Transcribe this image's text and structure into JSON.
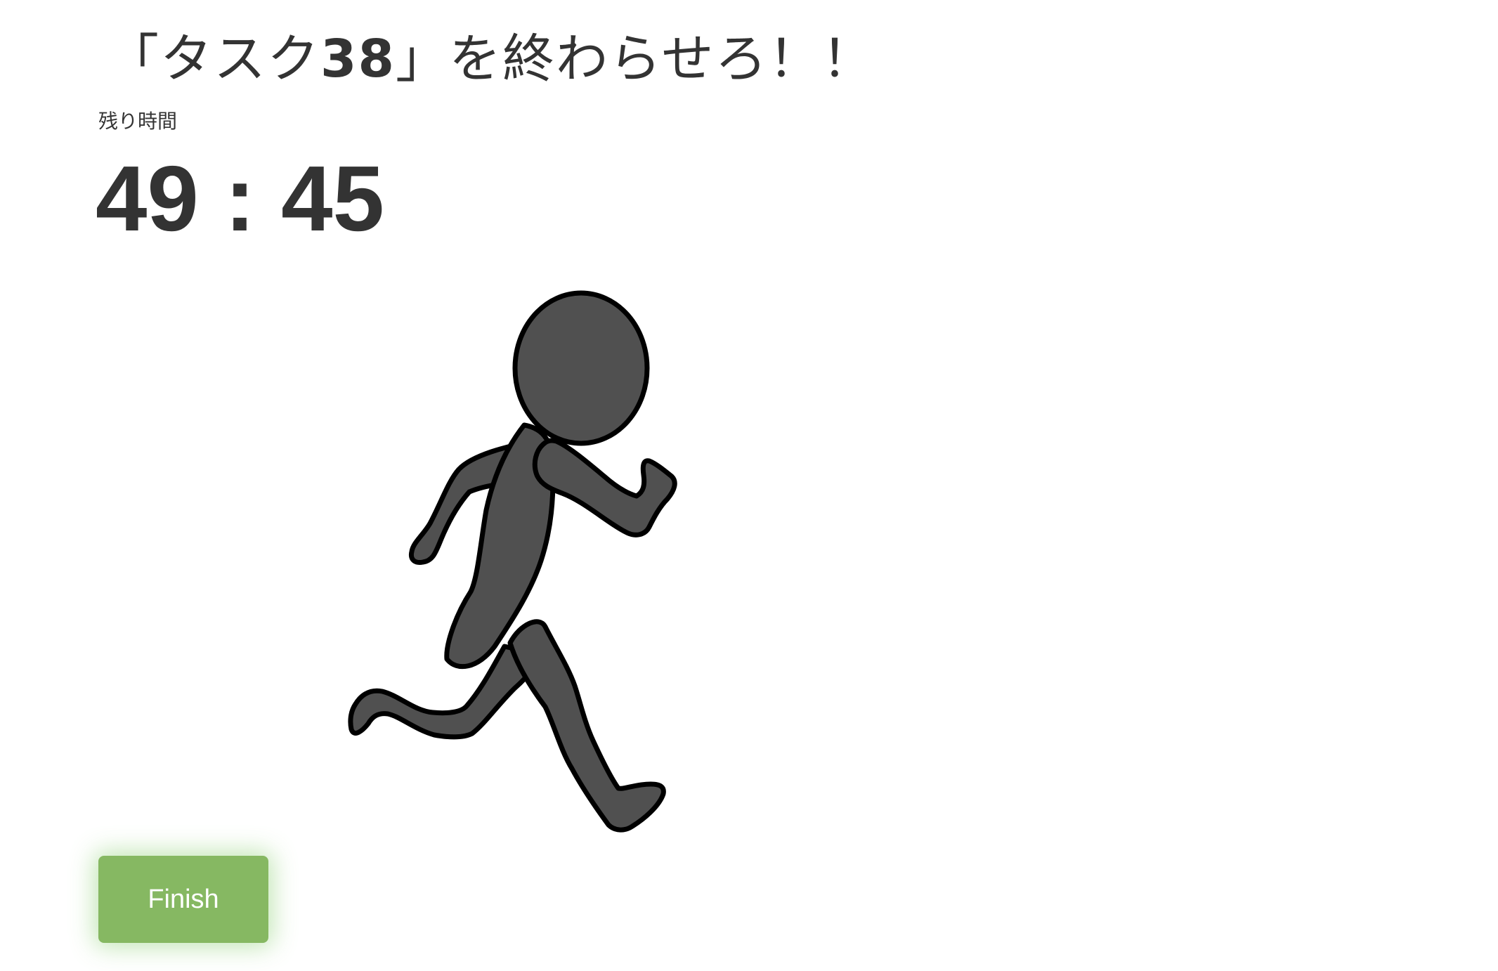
{
  "header": {
    "title_open": "「タスク",
    "task_number": "38",
    "title_close": "」を終わらせろ！！"
  },
  "timer": {
    "label": "残り時間",
    "value": "49 : 45"
  },
  "illustration": {
    "icon": "running-person-icon",
    "fill_color": "#505050",
    "outline_color": "#000000"
  },
  "actions": {
    "finish_label": "Finish",
    "finish_color": "#86b862"
  }
}
